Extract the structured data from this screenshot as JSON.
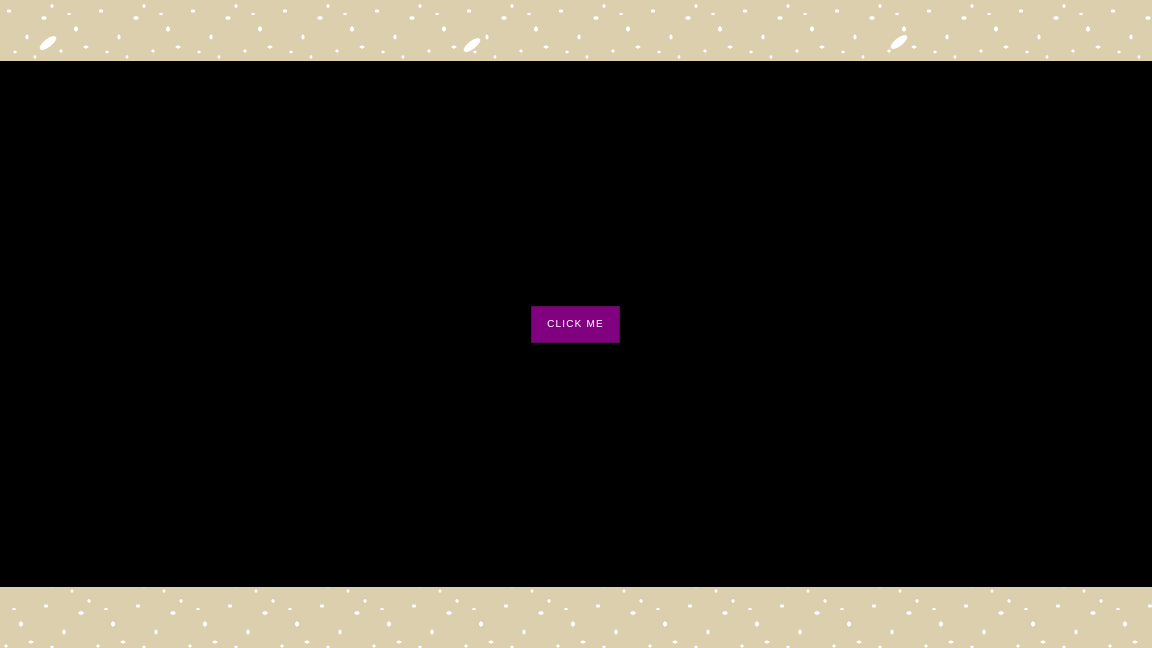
{
  "button": {
    "label": "CLICK ME"
  },
  "colors": {
    "background": "#000000",
    "border_band": "#dccfad",
    "speckle": "#ffffff",
    "button": "#800080",
    "button_text": "#ffffff"
  }
}
